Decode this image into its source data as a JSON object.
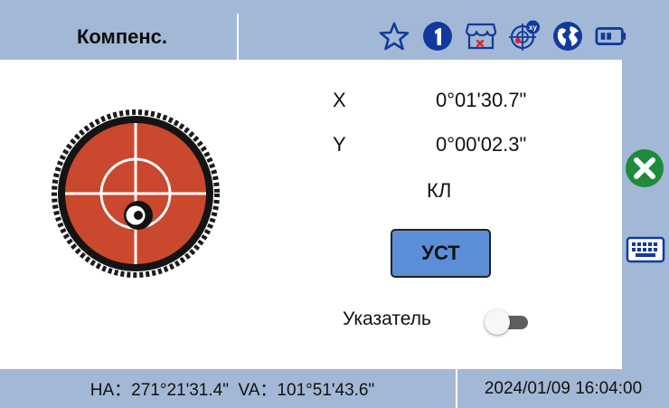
{
  "header": {
    "title": "Компенс.",
    "icons": [
      "star-outline-icon",
      "info-one-icon",
      "store-error-icon",
      "crosshair-xy-icon",
      "globe-icon",
      "battery-icon"
    ]
  },
  "readings": {
    "x_label": "X",
    "x_value": "0°01'30.7\"",
    "y_label": "Y",
    "y_value": "0°00'02.3\"",
    "face": "КЛ"
  },
  "actions": {
    "set_label": "УСТ"
  },
  "pointer": {
    "label": "Указатель",
    "enabled": false
  },
  "side_controls": [
    "close-icon",
    "keyboard-icon"
  ],
  "footer": {
    "angles": "HA：271°21'31.4\"  VA：101°51'43.6\"",
    "datetime": "2024/01/09 16:04:00"
  },
  "colors": {
    "bar": "#a3b8d6",
    "button": "#5b8ed6",
    "bubble_red": "#c9482e",
    "close_green": "#1e8a3a"
  }
}
